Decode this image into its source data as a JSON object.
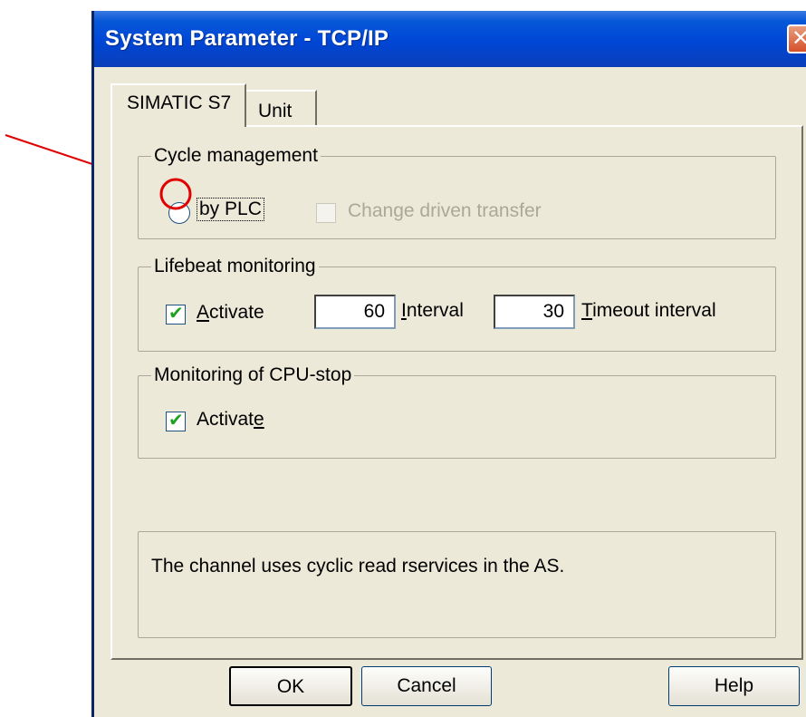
{
  "window": {
    "title": "System Parameter - TCP/IP",
    "close_glyph": "✕"
  },
  "tabs": [
    {
      "label": "SIMATIC S7",
      "selected": true
    },
    {
      "label": "Unit",
      "selected": false
    }
  ],
  "cycle_management": {
    "label": "Cycle management",
    "by_plc_label": "by PLC",
    "by_plc_selected": false,
    "change_driven_label": "Change driven transfer",
    "change_driven_enabled": false,
    "change_driven_checked": false
  },
  "lifebeat_monitoring": {
    "label": "Lifebeat monitoring",
    "activate_label_first": "A",
    "activate_label_rest": "ctivate",
    "activate_checked": true,
    "interval_value": "60",
    "interval_label_first": "I",
    "interval_label_rest": "nterval",
    "timeout_value": "30",
    "timeout_label_first": "T",
    "timeout_label_rest": "imeout interval"
  },
  "cpu_stop_monitoring": {
    "label": "Monitoring of CPU-stop",
    "activate_label_start": "Activat",
    "activate_label_underlined": "e",
    "activate_checked": true
  },
  "info_text": "The channel uses cyclic read rservices in the AS.",
  "buttons": {
    "ok": "OK",
    "cancel": "Cancel",
    "help": "Help"
  },
  "icons": {
    "check": "✔",
    "annotation": "red-arrow-and-circle"
  },
  "colors": {
    "titlebar": "#0046d6",
    "dialog_bg": "#ece9d8",
    "annotation": "#e00000",
    "check": "#21a121"
  }
}
